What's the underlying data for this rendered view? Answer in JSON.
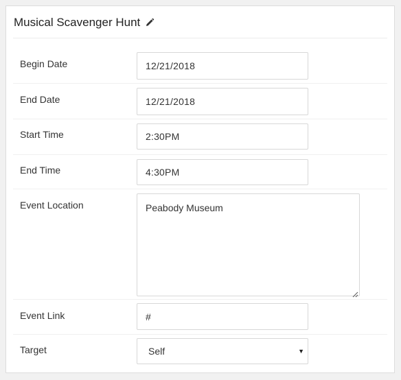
{
  "panel": {
    "title": "Musical Scavenger Hunt",
    "edit_icon": "pencil-icon"
  },
  "form": {
    "begin_date": {
      "label": "Begin Date",
      "value": "12/21/2018"
    },
    "end_date": {
      "label": "End Date",
      "value": "12/21/2018"
    },
    "start_time": {
      "label": "Start Time",
      "value": "2:30PM"
    },
    "end_time": {
      "label": "End Time",
      "value": "4:30PM"
    },
    "event_location": {
      "label": "Event Location",
      "value": "Peabody Museum"
    },
    "event_link": {
      "label": "Event Link",
      "value": "#"
    },
    "target": {
      "label": "Target",
      "value": "Self",
      "arrow_icon": "chevron-down-icon"
    }
  },
  "colors": {
    "background": "#f1f1f1",
    "panel": "#ffffff",
    "border": "#d7d7d7",
    "text": "#333333"
  }
}
